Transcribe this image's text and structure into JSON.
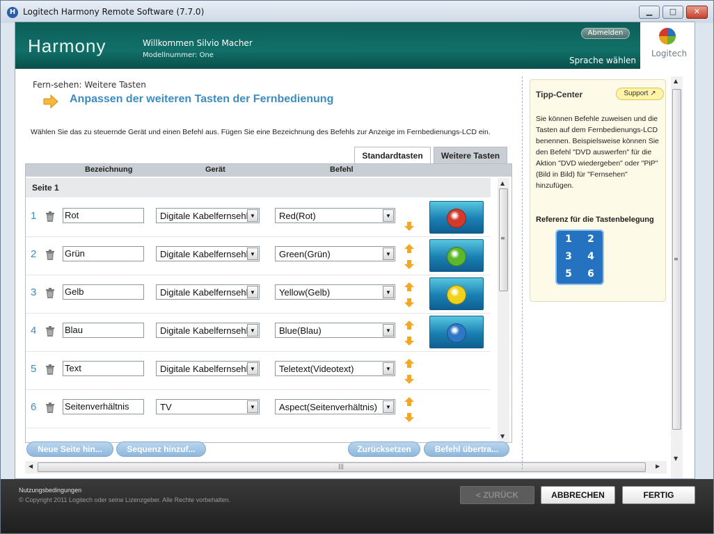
{
  "window": {
    "title": "Logitech Harmony Remote Software (7.7.0)",
    "minimize_label": "▁",
    "maximize_label": "□",
    "close_label": "✕"
  },
  "header": {
    "logo_text": "Harmony",
    "welcome": "Willkommen Silvio Macher",
    "model": "Modellnummer: One",
    "logout_label": "Abmelden",
    "language_label": "Sprache wählen",
    "brand": "Logitech"
  },
  "main": {
    "breadcrumb": "Fern-sehen: Weitere Tasten",
    "title": "Anpassen der weiteren Tasten der Fernbedienung",
    "instruction": "Wählen Sie das zu steuernde Gerät und einen Befehl aus. Fügen Sie eine Bezeichnung des Befehls zur Anzeige im Fernbedienungs-LCD ein.",
    "tabs": [
      {
        "label": "Standardtasten",
        "active": false
      },
      {
        "label": "Weitere Tasten",
        "active": true
      }
    ],
    "columns": [
      "Bezeichnung",
      "Gerät",
      "Befehl"
    ],
    "page_label": "Seite 1",
    "rows": [
      {
        "num": "1",
        "name": "Rot",
        "device": "Digitale Kabelfernsehl",
        "command": "Red(Rot)",
        "color": "#d43a2a",
        "has_up": false
      },
      {
        "num": "2",
        "name": "Grün",
        "device": "Digitale Kabelfernsehl",
        "command": "Green(Grün)",
        "color": "#5cb82a",
        "has_up": true
      },
      {
        "num": "3",
        "name": "Gelb",
        "device": "Digitale Kabelfernsehl",
        "command": "Yellow(Gelb)",
        "color": "#f0d21a",
        "has_up": true
      },
      {
        "num": "4",
        "name": "Blau",
        "device": "Digitale Kabelfernsehl",
        "command": "Blue(Blau)",
        "color": "#2f78c6",
        "has_up": true
      },
      {
        "num": "5",
        "name": "Text",
        "device": "Digitale Kabelfernsehl",
        "command": "Teletext(Videotext)",
        "color": null,
        "has_up": true
      },
      {
        "num": "6",
        "name": "Seitenverhältnis",
        "device": "TV",
        "command": "Aspect(Seitenverhältnis)",
        "color": null,
        "has_up": true
      }
    ],
    "buttons": {
      "new_page": "Neue Seite hin...",
      "add_sequence": "Sequenz hinzuf...",
      "reset": "Zurücksetzen",
      "transfer_command": "Befehl übertra..."
    }
  },
  "tips": {
    "title": "Tipp-Center",
    "support_label": "Support",
    "text": "Sie können Befehle zuweisen und die Tasten auf dem Fernbedienungs-LCD benennen. Beispielsweise können Sie den Befehl \"DVD auswerfen\" für die Aktion \"DVD wiedergeben\" oder \"PiP\" (Bild in Bild) für \"Fernsehen\" hinzufügen.",
    "reference_title": "Referenz für die Tastenbelegung",
    "keypad": [
      "1",
      "2",
      "3",
      "4",
      "5",
      "6"
    ]
  },
  "footer": {
    "terms": "Nutzungsbedingungen",
    "copyright": "© Copyright 2011 Logitech oder seine Lizenzgeber. Alle Rechte vorbehalten.",
    "back_label": "< ZURÜCK",
    "cancel_label": "ABBRECHEN",
    "finish_label": "FERTIG"
  },
  "colors": {
    "accent_blue": "#3d8bbf",
    "header_teal": "#117069",
    "pill_blue": "#9fc4e4"
  }
}
